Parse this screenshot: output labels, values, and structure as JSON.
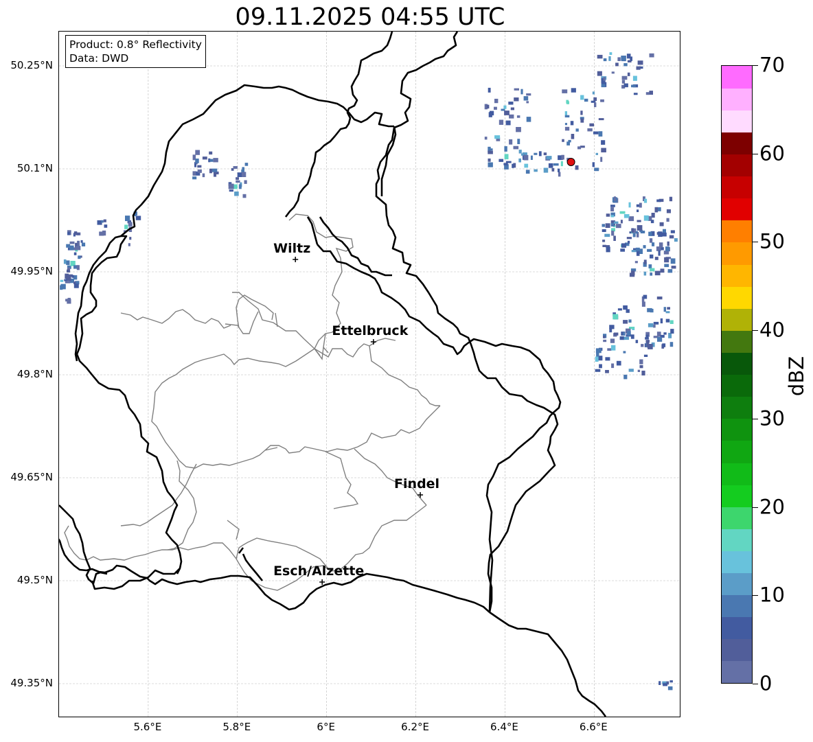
{
  "title": "09.11.2025 04:55 UTC",
  "info": {
    "product": "Product: 0.8° Reflectivity",
    "data": "Data: DWD"
  },
  "lat_labels": [
    "50.25°N",
    "50.1°N",
    "49.95°N",
    "49.8°N",
    "49.65°N",
    "49.5°N",
    "49.35°N"
  ],
  "lon_labels": [
    "5.6°E",
    "5.8°E",
    "6°E",
    "6.2°E",
    "6.4°E",
    "6.6°E"
  ],
  "extent": {
    "lon_min": 5.4,
    "lon_max": 6.795,
    "lat_min": 49.3,
    "lat_max": 50.3
  },
  "cities": [
    {
      "name": "Wiltz",
      "lon": 5.93,
      "lat": 49.968
    },
    {
      "name": "Ettelbruck",
      "lon": 6.105,
      "lat": 49.848
    },
    {
      "name": "Findel",
      "lon": 6.21,
      "lat": 49.625
    },
    {
      "name": "Esch/Alzette",
      "lon": 5.99,
      "lat": 49.498
    }
  ],
  "radar_site": {
    "lon": 6.548,
    "lat": 50.11,
    "color": "#e01010"
  },
  "colorbar": {
    "unit": "dBZ",
    "ticks": [
      "0",
      "10",
      "20",
      "30",
      "40",
      "50",
      "60",
      "70"
    ],
    "min": 0,
    "max": 70,
    "step": 2.5,
    "colors": [
      "#6470a6",
      "#515e9a",
      "#425ba0",
      "#4a78b1",
      "#5b9dc8",
      "#68c2dc",
      "#62d6c2",
      "#3dd66d",
      "#14cc1f",
      "#11bb18",
      "#10a712",
      "#0f930f",
      "#0e7e0e",
      "#0a6a0a",
      "#08580a",
      "#43780f",
      "#b0b206",
      "#ffd800",
      "#ffb600",
      "#ff9a00",
      "#ff7f00",
      "#e10000",
      "#c70000",
      "#a30000",
      "#7d0000",
      "#ffdbff",
      "#ffb0ff",
      "#ff6bff",
      "#eb3aeb"
    ]
  }
}
